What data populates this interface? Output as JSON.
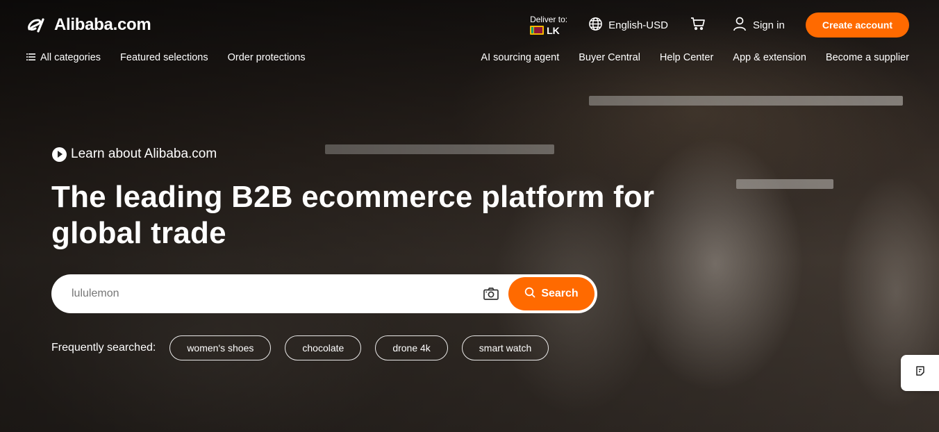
{
  "brand": {
    "name": "Alibaba.com"
  },
  "topbar": {
    "deliver_label": "Deliver to:",
    "deliver_country": "LK",
    "language": "English-USD",
    "signin": "Sign in",
    "create_account": "Create account"
  },
  "nav": {
    "left": [
      "All categories",
      "Featured selections",
      "Order protections"
    ],
    "right": [
      "AI sourcing agent",
      "Buyer Central",
      "Help Center",
      "App & extension",
      "Become a supplier"
    ]
  },
  "hero": {
    "learn": "Learn about Alibaba.com",
    "headline": "The leading B2B ecommerce platform for global trade",
    "search_placeholder": "lululemon",
    "search_button": "Search",
    "frequent_label": "Frequently searched:",
    "frequent": [
      "women's shoes",
      "chocolate",
      "drone 4k",
      "smart watch"
    ]
  },
  "colors": {
    "accent": "#ff6a00"
  },
  "icons": [
    "menu-icon",
    "globe-icon",
    "cart-icon",
    "user-icon",
    "camera-icon",
    "search-icon",
    "play-icon",
    "feedback-icon"
  ]
}
